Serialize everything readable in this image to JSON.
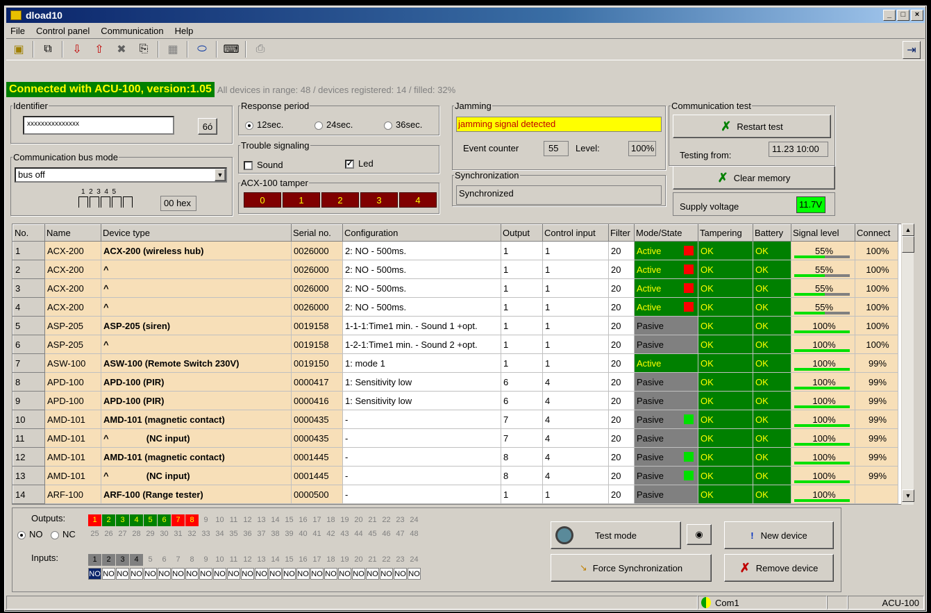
{
  "window": {
    "title": "dload10"
  },
  "menu": [
    "File",
    "Control panel",
    "Communication",
    "Help"
  ],
  "status": {
    "connected": "Connected with ACU-100, version:1.05",
    "range": "All devices in range: 48 / devices registered: 14 / filled: 32%"
  },
  "identifier": {
    "label": "Identifier",
    "value": "xxxxxxxxxxxxxxx",
    "btn": "6ó"
  },
  "busmode": {
    "label": "Communication bus mode",
    "value": "bus off",
    "dip_numbers": "1  2  3  4  5",
    "hex": "00 hex"
  },
  "response": {
    "label": "Response period",
    "opts": [
      "12sec.",
      "24sec.",
      "36sec."
    ]
  },
  "trouble": {
    "label": "Trouble signaling",
    "sound": "Sound",
    "led": "Led"
  },
  "tamper": {
    "label": "ACX-100 tamper",
    "cells": [
      "0",
      "1",
      "2",
      "3",
      "4"
    ]
  },
  "jamming": {
    "label": "Jamming",
    "msg": "jamming signal detected",
    "counter_label": "Event counter",
    "counter": "55",
    "level_label": "Level:",
    "level": "100%"
  },
  "sync": {
    "label": "Synchronization",
    "value": "Synchronized"
  },
  "commtest": {
    "label": "Communication test",
    "restart": "Restart test",
    "from_label": "Testing from:",
    "from": "11.23 10:00",
    "clear": "Clear memory",
    "supply_label": "Supply voltage",
    "supply": "11.7V"
  },
  "columns": [
    "No.",
    "Name",
    "Device type",
    "Serial no.",
    "Configuration",
    "Output",
    "Control input",
    "Filter",
    "Mode/State",
    "Tampering",
    "Battery",
    "Signal level",
    "Connect"
  ],
  "rows": [
    {
      "no": "1",
      "name": "ACX-200",
      "type": "ACX-200 (wireless hub)",
      "serial": "0026000",
      "cfg": "2: NO - 500ms.",
      "out": "1",
      "ci": "1",
      "flt": "20",
      "mode": "Active",
      "led": "red",
      "tamp": "OK",
      "bat": "OK",
      "sig": "55%",
      "sigv": 0.55,
      "conn": "100%"
    },
    {
      "no": "2",
      "name": "ACX-200",
      "type": "^",
      "serial": "0026000",
      "cfg": "2: NO - 500ms.",
      "out": "1",
      "ci": "1",
      "flt": "20",
      "mode": "Active",
      "led": "red",
      "tamp": "OK",
      "bat": "OK",
      "sig": "55%",
      "sigv": 0.55,
      "conn": "100%"
    },
    {
      "no": "3",
      "name": "ACX-200",
      "type": "^",
      "serial": "0026000",
      "cfg": "2: NO - 500ms.",
      "out": "1",
      "ci": "1",
      "flt": "20",
      "mode": "Active",
      "led": "red",
      "tamp": "OK",
      "bat": "OK",
      "sig": "55%",
      "sigv": 0.55,
      "conn": "100%"
    },
    {
      "no": "4",
      "name": "ACX-200",
      "type": "^",
      "serial": "0026000",
      "cfg": "2: NO - 500ms.",
      "out": "1",
      "ci": "1",
      "flt": "20",
      "mode": "Active",
      "led": "red",
      "tamp": "OK",
      "bat": "OK",
      "sig": "55%",
      "sigv": 0.55,
      "conn": "100%"
    },
    {
      "no": "5",
      "name": "ASP-205",
      "type": "ASP-205 (siren)",
      "serial": "0019158",
      "cfg": "1-1-1:Time1 min. - Sound 1 +opt.",
      "out": "1",
      "ci": "1",
      "flt": "20",
      "mode": "Pasive",
      "led": "",
      "tamp": "OK",
      "bat": "OK",
      "sig": "100%",
      "sigv": 1,
      "conn": "100%"
    },
    {
      "no": "6",
      "name": "ASP-205",
      "type": "^",
      "serial": "0019158",
      "cfg": "1-2-1:Time1 min. - Sound 2 +opt.",
      "out": "1",
      "ci": "1",
      "flt": "20",
      "mode": "Pasive",
      "led": "",
      "tamp": "OK",
      "bat": "OK",
      "sig": "100%",
      "sigv": 1,
      "conn": "100%"
    },
    {
      "no": "7",
      "name": "ASW-100",
      "type": "ASW-100 (Remote Switch 230V)",
      "serial": "0019150",
      "cfg": "1: mode 1",
      "out": "1",
      "ci": "1",
      "flt": "20",
      "mode": "Active",
      "led": "",
      "tamp": "OK",
      "bat": "OK",
      "sig": "100%",
      "sigv": 1,
      "conn": "99%"
    },
    {
      "no": "8",
      "name": "APD-100",
      "type": "APD-100 (PIR)",
      "serial": "0000417",
      "cfg": "1: Sensitivity low",
      "out": "6",
      "ci": "4",
      "flt": "20",
      "mode": "Pasive",
      "led": "",
      "tamp": "OK",
      "bat": "OK",
      "sig": "100%",
      "sigv": 1,
      "conn": "99%"
    },
    {
      "no": "9",
      "name": "APD-100",
      "type": "APD-100 (PIR)",
      "serial": "0000416",
      "cfg": "1: Sensitivity low",
      "out": "6",
      "ci": "4",
      "flt": "20",
      "mode": "Pasive",
      "led": "",
      "tamp": "OK",
      "bat": "OK",
      "sig": "100%",
      "sigv": 1,
      "conn": "99%"
    },
    {
      "no": "10",
      "name": "AMD-101",
      "type": "AMD-101 (magnetic contact)",
      "serial": "0000435",
      "cfg": "-",
      "out": "7",
      "ci": "4",
      "flt": "20",
      "mode": "Pasive",
      "led": "green",
      "tamp": "OK",
      "bat": "OK",
      "sig": "100%",
      "sigv": 1,
      "conn": "99%"
    },
    {
      "no": "11",
      "name": "AMD-101",
      "type": "^               (NC input)",
      "serial": "0000435",
      "cfg": "-",
      "out": "7",
      "ci": "4",
      "flt": "20",
      "mode": "Pasive",
      "led": "",
      "tamp": "OK",
      "bat": "OK",
      "sig": "100%",
      "sigv": 1,
      "conn": "99%"
    },
    {
      "no": "12",
      "name": "AMD-101",
      "type": "AMD-101 (magnetic contact)",
      "serial": "0001445",
      "cfg": "-",
      "out": "8",
      "ci": "4",
      "flt": "20",
      "mode": "Pasive",
      "led": "green",
      "tamp": "OK",
      "bat": "OK",
      "sig": "100%",
      "sigv": 1,
      "conn": "99%"
    },
    {
      "no": "13",
      "name": "AMD-101",
      "type": "^               (NC input)",
      "serial": "0001445",
      "cfg": "-",
      "out": "8",
      "ci": "4",
      "flt": "20",
      "mode": "Pasive",
      "led": "green",
      "tamp": "OK",
      "bat": "OK",
      "sig": "100%",
      "sigv": 1,
      "conn": "99%"
    },
    {
      "no": "14",
      "name": "ARF-100",
      "type": "ARF-100 (Range tester)",
      "serial": "0000500",
      "cfg": "-",
      "out": "1",
      "ci": "1",
      "flt": "20",
      "mode": "Pasive",
      "led": "",
      "tamp": "OK",
      "bat": "OK",
      "sig": "100%",
      "sigv": 1,
      "conn": ""
    }
  ],
  "outputs": {
    "label": "Outputs:",
    "no": "NO",
    "nc": "NC",
    "row1": [
      "1",
      "2",
      "3",
      "4",
      "5",
      "6",
      "7",
      "8",
      "9",
      "10",
      "11",
      "12",
      "13",
      "14",
      "15",
      "16",
      "17",
      "18",
      "19",
      "20",
      "21",
      "22",
      "23",
      "24"
    ],
    "row1cls": [
      "r",
      "g",
      "g",
      "g",
      "g",
      "g",
      "r",
      "r",
      "",
      "",
      "",
      "",
      "",
      "",
      "",
      "",
      "",
      "",
      "",
      "",
      "",
      "",
      "",
      ""
    ],
    "row2": [
      "25",
      "26",
      "27",
      "28",
      "29",
      "30",
      "31",
      "32",
      "33",
      "34",
      "35",
      "36",
      "37",
      "38",
      "39",
      "40",
      "41",
      "42",
      "43",
      "44",
      "45",
      "46",
      "47",
      "48"
    ]
  },
  "inputs": {
    "label": "Inputs:",
    "nums": [
      "1",
      "2",
      "3",
      "4",
      "5",
      "6",
      "7",
      "8",
      "9",
      "10",
      "11",
      "12",
      "13",
      "14",
      "15",
      "16",
      "17",
      "18",
      "19",
      "20",
      "21",
      "22",
      "23",
      "24"
    ],
    "vals": [
      "NO",
      "NO",
      "NO",
      "NO",
      "NO",
      "NO",
      "NO",
      "NO",
      "NO",
      "NO",
      "NO",
      "NO",
      "NO",
      "NO",
      "NO",
      "NO",
      "NO",
      "NO",
      "NO",
      "NO",
      "NO",
      "NO",
      "NO",
      "NO"
    ]
  },
  "buttons": {
    "test": "Test mode",
    "force": "Force Synchronization",
    "new": "New device",
    "remove": "Remove device"
  },
  "statusbar": {
    "port": "Com1",
    "device": "ACU-100"
  }
}
